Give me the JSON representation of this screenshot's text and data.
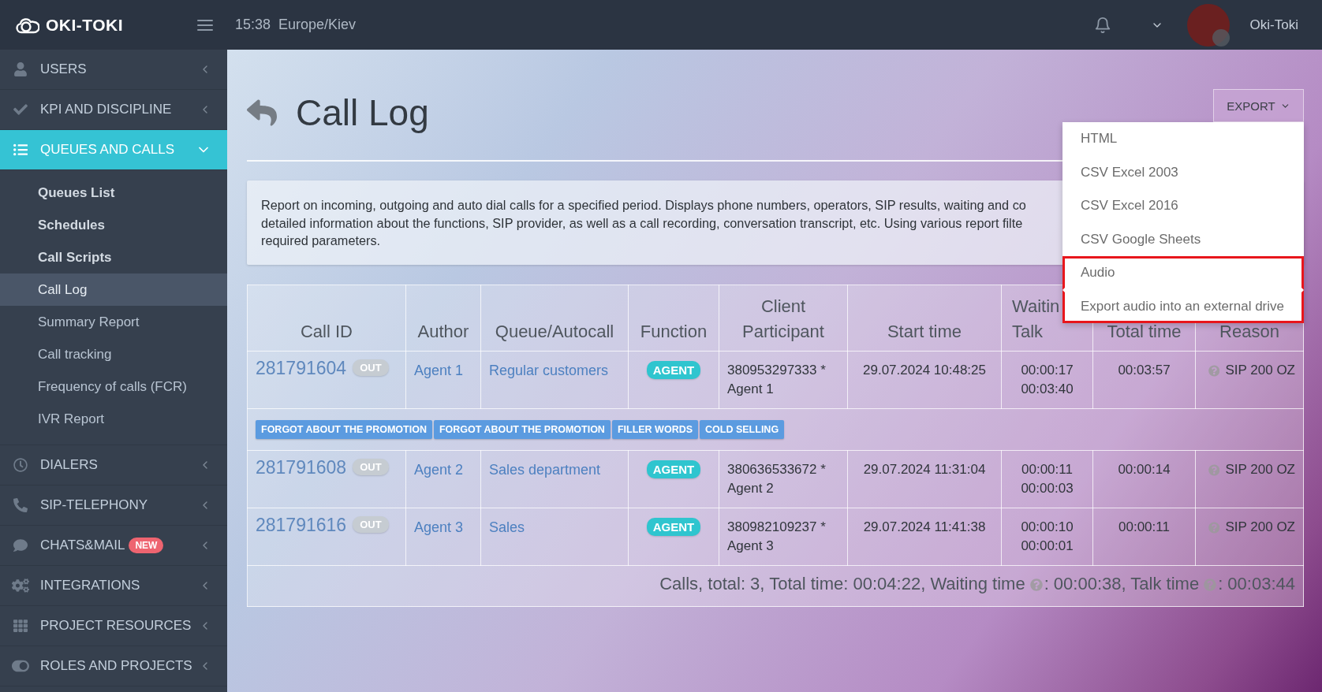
{
  "header": {
    "logo": "OKI-TOKI",
    "time": "15:38",
    "timezone": "Europe/Kiev",
    "user": "Oki-Toki"
  },
  "sidebar": {
    "items": [
      {
        "label": "USERS",
        "selected": false,
        "expanded": false
      },
      {
        "label": "KPI AND DISCIPLINE",
        "selected": false,
        "expanded": false
      },
      {
        "label": "QUEUES AND CALLS",
        "selected": true,
        "expanded": true,
        "children": [
          {
            "label": "Queues List",
            "kind": "heading",
            "selected": false
          },
          {
            "label": "Schedules",
            "kind": "heading",
            "selected": false
          },
          {
            "label": "Call Scripts",
            "kind": "heading",
            "selected": false
          },
          {
            "label": "Call Log",
            "kind": "link",
            "selected": true
          },
          {
            "label": "Summary Report",
            "kind": "link",
            "selected": false
          },
          {
            "label": "Call tracking",
            "kind": "link",
            "selected": false
          },
          {
            "label": "Frequency of calls (FCR)",
            "kind": "link",
            "selected": false
          },
          {
            "label": "IVR Report",
            "kind": "link",
            "selected": false
          }
        ]
      },
      {
        "label": "DIALERS",
        "selected": false,
        "expanded": false
      },
      {
        "label": "SIP-TELEPHONY",
        "selected": false,
        "expanded": false
      },
      {
        "label": "CHATS&MAIL",
        "badge": "NEW",
        "selected": false,
        "expanded": false
      },
      {
        "label": "INTEGRATIONS",
        "selected": false,
        "expanded": false
      },
      {
        "label": "PROJECT RESOURCES",
        "selected": false,
        "expanded": false
      },
      {
        "label": "ROLES AND PROJECTS",
        "selected": false,
        "expanded": false
      }
    ]
  },
  "page": {
    "title": "Call Log",
    "export": {
      "label": "EXPORT",
      "expanded": true,
      "options": [
        {
          "label": "HTML",
          "highlighted": false
        },
        {
          "label": "CSV Excel 2003",
          "highlighted": false
        },
        {
          "label": "CSV Excel 2016",
          "highlighted": false
        },
        {
          "label": "CSV Google Sheets",
          "highlighted": false
        },
        {
          "label": "Audio",
          "highlighted": true
        },
        {
          "label": "Export audio into an external drive",
          "highlighted": true
        }
      ]
    },
    "description": [
      "Report on incoming, outgoing and auto dial calls for a specified period. Displays phone numbers, operators, SIP results, waiting and co",
      "detailed information about the functions, SIP provider, as well as a call recording, conversation transcript, etc. Using various report filte",
      "required parameters."
    ]
  },
  "table": {
    "columns": [
      {
        "lines": [
          "Call ID"
        ]
      },
      {
        "lines": [
          "Author"
        ]
      },
      {
        "lines": [
          "Queue/Autocall"
        ]
      },
      {
        "lines": [
          "Function"
        ]
      },
      {
        "lines": [
          "Client",
          "Participant"
        ]
      },
      {
        "lines": [
          "Start time"
        ]
      },
      {
        "lines": [
          "Waitin",
          "Talk"
        ]
      },
      {
        "lines": [
          "Total time"
        ]
      },
      {
        "lines": [
          "Reason"
        ]
      }
    ],
    "rows": [
      {
        "call_id": "281791604",
        "direction": "OUT",
        "author": "Agent 1",
        "queue": "Regular customers",
        "function": "AGENT",
        "client": "380953297333 *",
        "participant": "Agent 1",
        "start": "29.07.2024 10:48:25",
        "waiting": "00:00:17",
        "talk": "00:03:40",
        "total": "00:03:57",
        "reason": "SIP 200 OZ",
        "tags": [
          "FORGOT ABOUT THE PROMOTION",
          "FORGOT ABOUT THE PROMOTION",
          "FILLER WORDS",
          "COLD SELLING"
        ]
      },
      {
        "call_id": "281791608",
        "direction": "OUT",
        "author": "Agent 2",
        "queue": "Sales department",
        "function": "AGENT",
        "client": "380636533672 *",
        "participant": "Agent 2",
        "start": "29.07.2024 11:31:04",
        "waiting": "00:00:11",
        "talk": "00:00:03",
        "total": "00:00:14",
        "reason": "SIP 200 OZ"
      },
      {
        "call_id": "281791616",
        "direction": "OUT",
        "author": "Agent 3",
        "queue": "Sales",
        "function": "AGENT",
        "client": "380982109237 *",
        "participant": "Agent 3",
        "start": "29.07.2024 11:41:38",
        "waiting": "00:00:10",
        "talk": "00:00:01",
        "total": "00:00:11",
        "reason": "SIP 200 OZ"
      }
    ],
    "summary": [
      "Calls, total: 3, Total time: 00:04:22, Waiting time",
      ": 00:00:38, Talk time",
      ": 00:03:44"
    ]
  }
}
